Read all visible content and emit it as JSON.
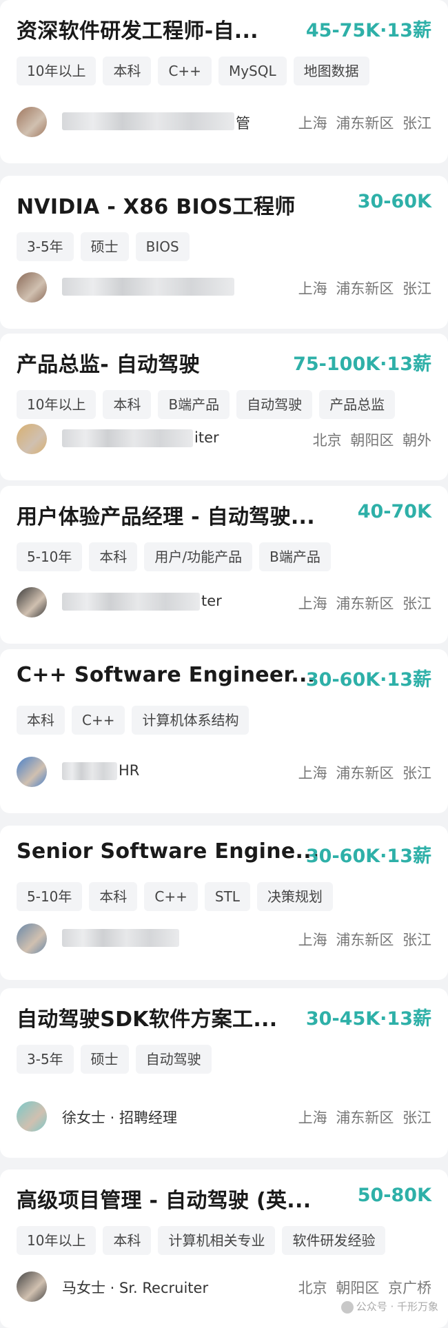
{
  "jobs": [
    {
      "title": "资深软件研发工程师-自...",
      "salary": "45-75K·13薪",
      "tags": [
        "10年以上",
        "本科",
        "C++",
        "MySQL",
        "地图数据"
      ],
      "recruiter": "",
      "recruiter_tail": "管",
      "location": "上海 浦东新区 张江",
      "avatar_color": "#a07860"
    },
    {
      "title": "NVIDIA - X86 BIOS工程师",
      "salary": "30-60K",
      "tags": [
        "3-5年",
        "硕士",
        "BIOS"
      ],
      "recruiter": "",
      "recruiter_tail": "",
      "location": "上海 浦东新区 张江",
      "avatar_color": "#8a6a58"
    },
    {
      "title": "产品总监- 自动驾驶",
      "salary": "75-100K·13薪",
      "tags": [
        "10年以上",
        "本科",
        "B端产品",
        "自动驾驶",
        "产品总监"
      ],
      "recruiter": "",
      "recruiter_tail": "iter",
      "location": "北京 朝阳区 朝外",
      "avatar_color": "#d8b070"
    },
    {
      "title": "用户体验产品经理 - 自动驾驶...",
      "salary": "40-70K",
      "tags": [
        "5-10年",
        "本科",
        "用户/功能产品",
        "B端产品"
      ],
      "recruiter": "",
      "recruiter_tail": "ter",
      "location": "上海 浦东新区 张江",
      "avatar_color": "#3a3a3a"
    },
    {
      "title": "C++ Software Engineer...",
      "salary": "30-60K·13薪",
      "tags": [
        "本科",
        "C++",
        "计算机体系结构"
      ],
      "recruiter": "",
      "recruiter_tail": "HR",
      "location": "上海 浦东新区 张江",
      "avatar_color": "#4a80c8"
    },
    {
      "title": "Senior Software Engine...",
      "salary": "30-60K·13薪",
      "tags": [
        "5-10年",
        "本科",
        "C++",
        "STL",
        "决策规划"
      ],
      "recruiter": "",
      "recruiter_tail": "",
      "location": "上海 浦东新区 张江",
      "avatar_color": "#6a88a8"
    },
    {
      "title": "自动驾驶SDK软件方案工...",
      "salary": "30-45K·13薪",
      "tags": [
        "3-5年",
        "硕士",
        "自动驾驶"
      ],
      "recruiter": "徐女士 · 招聘经理",
      "recruiter_tail": "",
      "location": "上海 浦东新区 张江",
      "avatar_color": "#7ac8c8"
    },
    {
      "title": "高级项目管理 - 自动驾驶 (英...",
      "salary": "50-80K",
      "tags": [
        "10年以上",
        "本科",
        "计算机相关专业",
        "软件研发经验"
      ],
      "recruiter": "马女士 · Sr. Recruiter",
      "recruiter_tail": "",
      "location": "北京 朝阳区 京广桥",
      "avatar_color": "#444444"
    }
  ],
  "watermark": "公众号 · 千形万象"
}
